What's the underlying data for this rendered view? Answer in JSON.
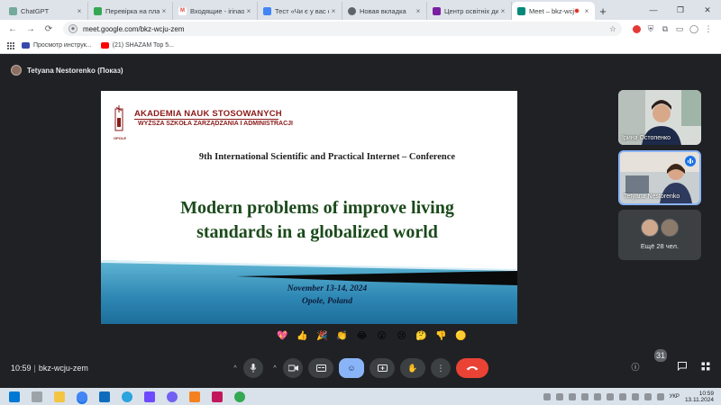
{
  "browser": {
    "tabs": [
      {
        "label": "ChatGPT",
        "color": "#74aa9c",
        "active": false
      },
      {
        "label": "Перевірка на плагіа",
        "color": "#34a853",
        "active": false
      },
      {
        "label": "Входящие - irinaost",
        "color": "#ea4335",
        "active": false
      },
      {
        "label": "Тест «Чи є у вас е",
        "color": "#4285f4",
        "active": false
      },
      {
        "label": "Новая вкладка",
        "color": "#5f6368",
        "active": false
      },
      {
        "label": "Центр освітніх дист",
        "color": "#7b1fa2",
        "active": false
      },
      {
        "label": "Meet – bkz-wcju",
        "color": "#00897b",
        "active": true
      }
    ],
    "new_tab_symbol": "+",
    "url": "meet.google.com/bkz-wcju-zem",
    "bookmarks": [
      {
        "label": "Просмотр инструк...",
        "color": "#3949ab"
      },
      {
        "label": "(21) SHAZAM Top 5...",
        "color": "#ff0000"
      }
    ]
  },
  "meet": {
    "presenter_label": "Tetyana Nestorenko (Показ)",
    "slide": {
      "uni_name_1": "AKADEMIA NAUK STOSOWANYCH",
      "uni_name_2": "WYŻSZA SZKOŁA ZARZĄDZANIA I ADMINISTRACJI",
      "logo_city": "OPOLE",
      "conference": "9th International Scientific and Practical Internet – Conference",
      "title_line1": "Modern problems of improve living",
      "title_line2": "standards in a globalized world",
      "dates": "November 13-14, 2024",
      "location": "Opole, Poland"
    },
    "participants": [
      {
        "name": "Ірина Остопенко"
      },
      {
        "name": "Tetyana Nestorenko"
      }
    ],
    "more_participants": "Ещё 28 чел.",
    "reactions": [
      "💖",
      "👍",
      "🎉",
      "👏",
      "😂",
      "😮",
      "😢",
      "🤔",
      "👎",
      "🟡"
    ],
    "time": "10:59",
    "meeting_code": "bkz-wcju-zem",
    "participant_count": "31"
  },
  "taskbar": {
    "lang": "УКР",
    "clock_time": "10:59",
    "clock_date": "13.11.2024"
  }
}
